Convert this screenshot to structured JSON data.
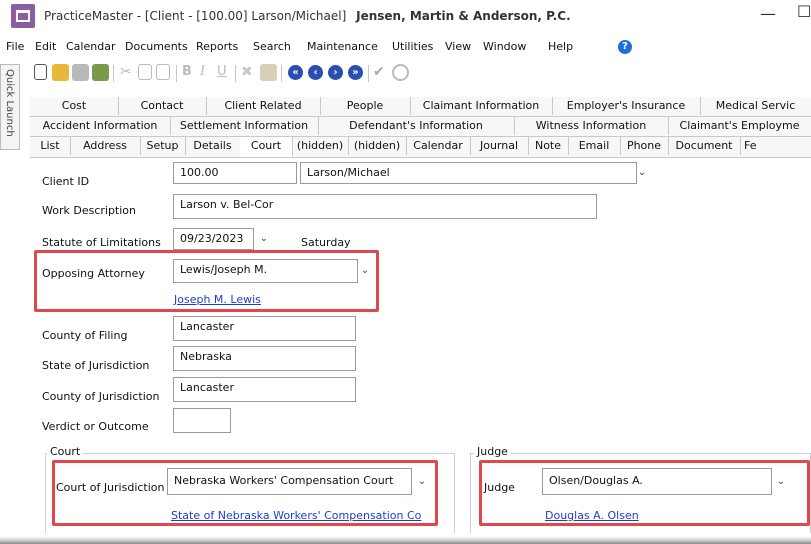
{
  "window": {
    "title": "PracticeMaster - [Client - [100.00] Larson/Michael]",
    "firm": "Jensen, Martin & Anderson, P.C.",
    "minimize": "—",
    "restore": "☐"
  },
  "menu": [
    "File",
    "Edit",
    "Calendar",
    "Documents",
    "Reports",
    "Search",
    "Maintenance",
    "Utilities",
    "View",
    "Window",
    "Help"
  ],
  "help_icon": "?",
  "quick_launch": "Quick Launch",
  "toolbar": {
    "icons": [
      "new-icon",
      "open-icon",
      "save-icon",
      "save-close-icon",
      "cut-icon",
      "copy-icon",
      "paste-icon",
      "bold-icon",
      "italic-icon",
      "underline-icon",
      "delete-icon",
      "find-icon",
      "first-record-icon",
      "previous-record-icon",
      "next-record-icon",
      "last-record-icon",
      "check-icon",
      "cancel-icon"
    ],
    "bold": "B",
    "italic": "I",
    "underline": "U"
  },
  "tabs": {
    "row1": [
      "Cost",
      "Contact",
      "Client Related",
      "People",
      "Claimant Information",
      "Employer's Insurance",
      "Medical Servic"
    ],
    "row2": [
      "Accident Information",
      "Settlement Information",
      "Defendant's Information",
      "Witness Information",
      "Claimant's Employme"
    ],
    "row3": [
      "List",
      "Address",
      "Setup",
      "Details",
      "Court",
      "(hidden)",
      "(hidden)",
      "Calendar",
      "Journal",
      "Note",
      "Email",
      "Phone",
      "Document",
      "Fe"
    ],
    "active": "Court"
  },
  "form": {
    "client_id_label": "Client ID",
    "client_id": "100.00",
    "client_name": "Larson/Michael",
    "work_description_label": "Work Description",
    "work_description": "Larson v. Bel-Cor",
    "statute_label": "Statute of Limitations",
    "statute_date": "09/23/2023",
    "statute_day": "Saturday",
    "opposing_attorney_label": "Opposing Attorney",
    "opposing_attorney": "Lewis/Joseph M.",
    "opposing_attorney_link": "Joseph M. Lewis",
    "county_filing_label": "County of Filing",
    "county_filing": "Lancaster",
    "state_jurisdiction_label": "State of Jurisdiction",
    "state_jurisdiction": "Nebraska",
    "county_jurisdiction_label": "County of Jurisdiction",
    "county_jurisdiction": "Lancaster",
    "verdict_label": "Verdict or Outcome",
    "verdict": "",
    "court_group": "Court",
    "court_jurisdiction_label": "Court of Jurisdiction",
    "court_jurisdiction": "Nebraska Workers' Compensation Court",
    "court_link": "State of Nebraska Workers' Compensation Co",
    "judge_group": "Judge",
    "judge_label": "Judge",
    "judge": "Olsen/Douglas A.",
    "judge_link": "Douglas A. Olsen"
  },
  "colors": {
    "highlight": "#e2474b",
    "link": "#1a3fcc",
    "app_icon": "#8a5fa0",
    "nav_buttons": "#2a4fb0"
  }
}
